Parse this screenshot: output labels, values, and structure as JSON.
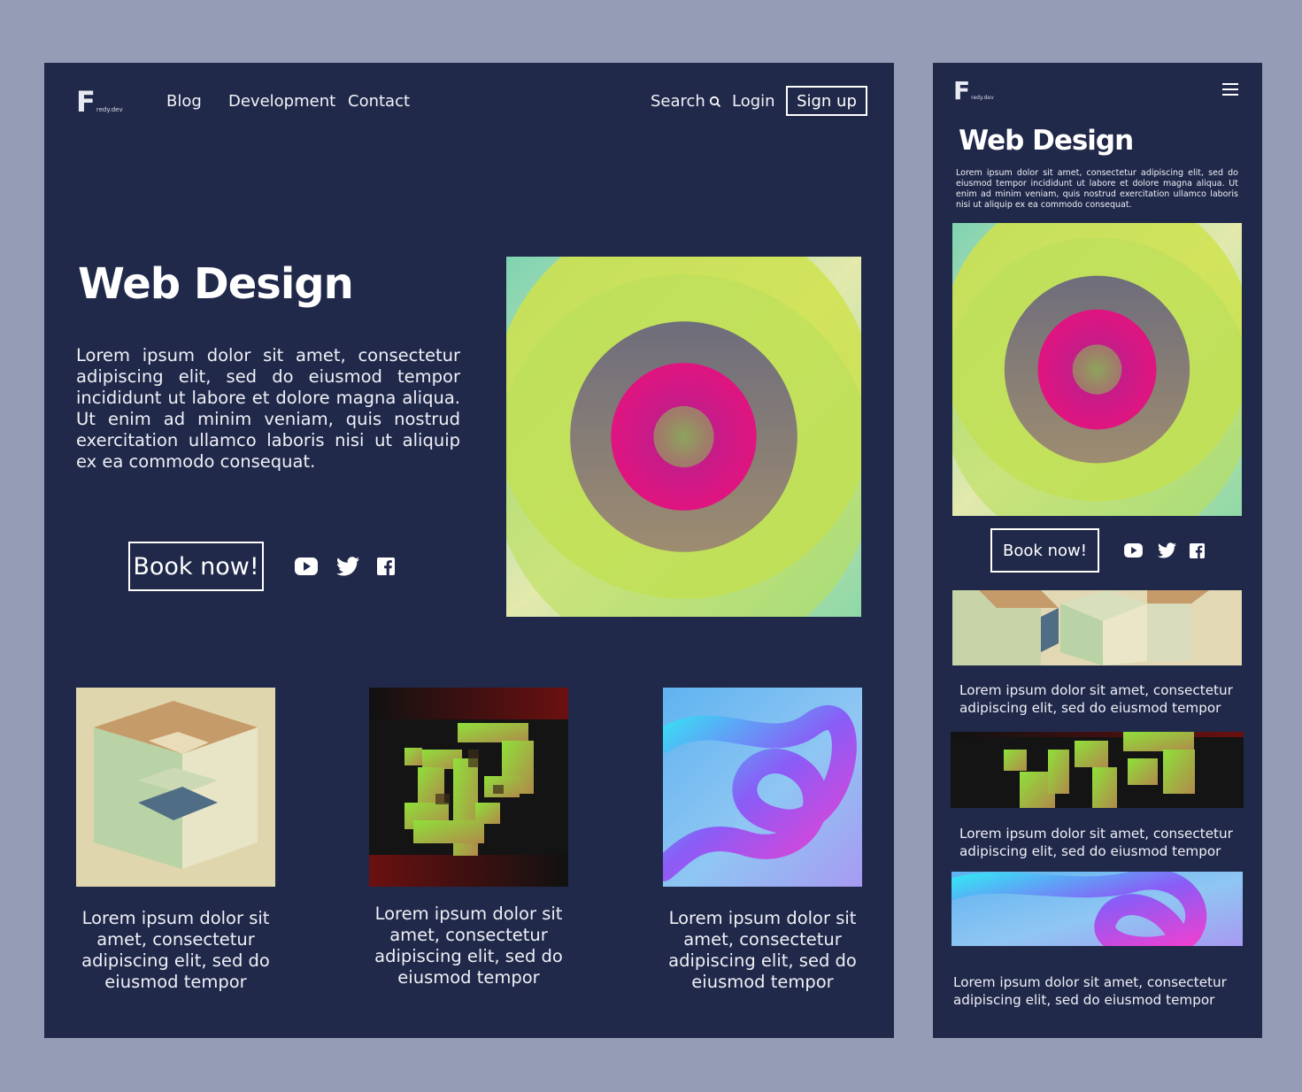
{
  "brand": {
    "letter": "F",
    "domain": "redy.dev"
  },
  "desktop": {
    "nav": {
      "blog": "Blog",
      "development": "Development",
      "contact": "Contact",
      "search": "Search",
      "login": "Login",
      "signup": "Sign up"
    },
    "hero": {
      "title": "Web Design",
      "body": "Lorem ipsum dolor sit amet, consectetur adipiscing elit, sed do eiusmod tempor incididunt ut labore et dolore magna aliqua. Ut enim ad minim veniam, quis nostrud exercitation ullamco laboris nisi ut aliquip ex ea commodo consequat.",
      "cta": "Book now!"
    },
    "cards": [
      {
        "caption": "Lorem ipsum dolor sit amet, consectetur adipiscing elit, sed do eiusmod tempor",
        "image": "isometric-cube-art"
      },
      {
        "caption": "Lorem ipsum dolor sit amet, consectetur adipiscing elit, sed do eiusmod tempor",
        "image": "maze-block-art"
      },
      {
        "caption": "Lorem ipsum dolor sit amet, consectetur adipiscing elit, sed do eiusmod tempor",
        "image": "neon-tube-art"
      }
    ]
  },
  "mobile": {
    "title": "Web Design",
    "body": "Lorem ipsum dolor sit amet, consectetur adipiscing elit, sed do eiusmod tempor incididunt ut labore et dolore magna aliqua. Ut enim ad minim veniam, quis nostrud exercitation ullamco laboris nisi ut aliquip ex ea commodo consequat.",
    "cta": "Book now!",
    "cards": [
      {
        "caption": "Lorem ipsum dolor sit amet, consectetur adipiscing elit, sed do eiusmod tempor",
        "image": "isometric-cube-art"
      },
      {
        "caption": "Lorem ipsum dolor sit amet, consectetur adipiscing elit, sed do eiusmod tempor",
        "image": "maze-block-art"
      },
      {
        "caption": "Lorem ipsum dolor sit amet, consectetur adipiscing elit, sed do eiusmod tempor",
        "image": "neon-tube-art"
      }
    ]
  },
  "icons": {
    "social": [
      "youtube-icon",
      "twitter-icon",
      "facebook-icon"
    ],
    "menu": "hamburger-menu-icon",
    "search": "search-icon"
  },
  "colors": {
    "page_bg": "#959cb5",
    "panel_bg": "#21294a",
    "text": "#ffffff"
  }
}
